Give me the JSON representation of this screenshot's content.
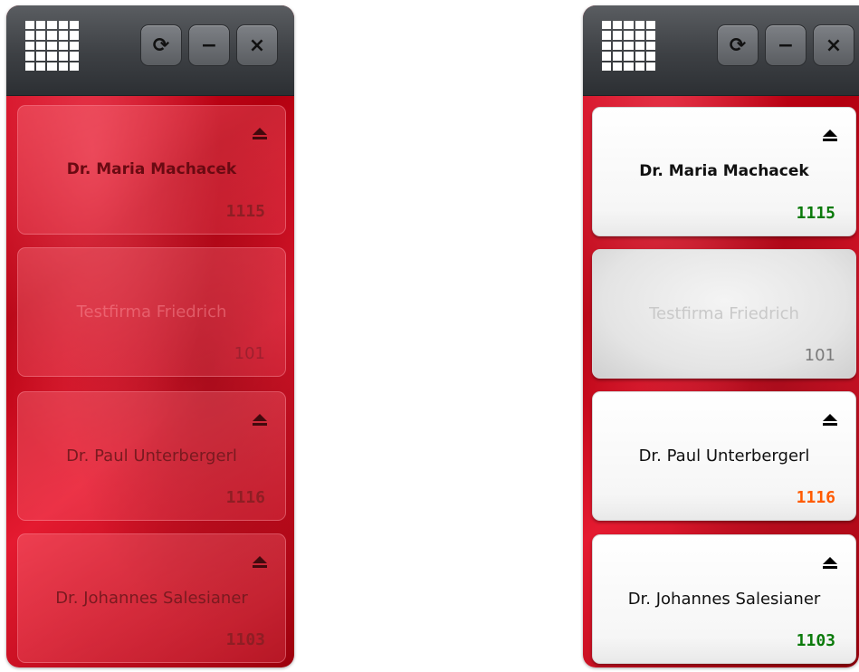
{
  "colors": {
    "green": "#0a7a0a",
    "orange": "#ff5a00",
    "gray": "#7a7a7a"
  },
  "widgets": [
    {
      "id": "left",
      "titlebar": {
        "menu_icon": "grid-icon",
        "refresh_icon": "⟳",
        "minimize_icon": "−",
        "close_icon": "×"
      },
      "cards": [
        {
          "name": "Dr. Maria Machacek",
          "number": "1115",
          "eject": true
        },
        {
          "name": "Testfirma Friedrich",
          "number": "101",
          "eject": false
        },
        {
          "name": "Dr. Paul Unterbergerl",
          "number": "1116",
          "eject": true
        },
        {
          "name": "Dr. Johannes Salesianer",
          "number": "1103",
          "eject": true
        }
      ]
    },
    {
      "id": "right",
      "titlebar": {
        "menu_icon": "grid-icon",
        "refresh_icon": "⟳",
        "minimize_icon": "−",
        "close_icon": "×"
      },
      "cards": [
        {
          "name": "Dr. Maria Machacek",
          "number": "1115",
          "eject": true
        },
        {
          "name": "Testfirma Friedrich",
          "number": "101",
          "eject": false
        },
        {
          "name": "Dr. Paul Unterbergerl",
          "number": "1116",
          "eject": true
        },
        {
          "name": "Dr. Johannes Salesianer",
          "number": "1103",
          "eject": true
        }
      ]
    }
  ]
}
